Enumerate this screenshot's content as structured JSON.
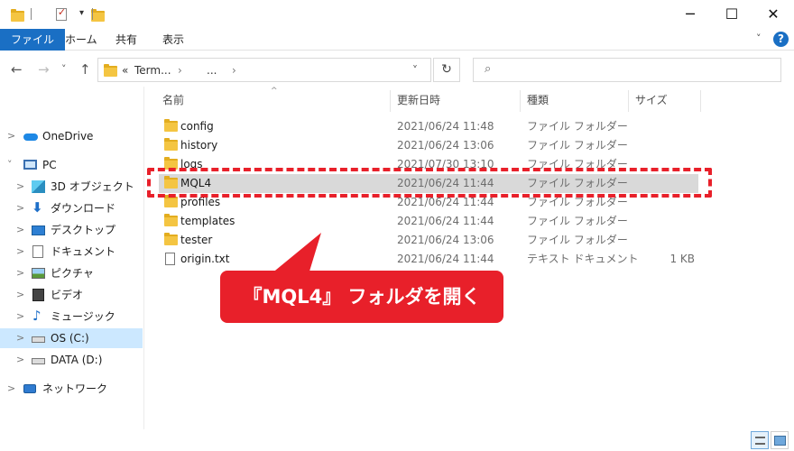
{
  "window": {
    "minimize": "─",
    "maximize": "☐",
    "close": "✕",
    "qa_dropdown": "▾"
  },
  "ribbon": {
    "tabs": [
      "ファイル",
      "ホーム",
      "共有",
      "表示"
    ],
    "expand": "˅",
    "help": "?"
  },
  "address": {
    "back": "←",
    "forward": "→",
    "recent": "˅",
    "up": "↑",
    "overflow": "«",
    "crumb1": "Term...",
    "crumb_sep": "›",
    "crumb2": "...",
    "crumb_sep2": "›",
    "dropdown": "˅",
    "refresh": "↻",
    "search_icon": "⌕"
  },
  "nav": {
    "items": [
      {
        "label": "OneDrive",
        "chevron": ">"
      },
      {
        "label": "PC",
        "chevron": "˅"
      },
      {
        "label": "3D オブジェクト",
        "chevron": ">"
      },
      {
        "label": "ダウンロード",
        "chevron": ">"
      },
      {
        "label": "デスクトップ",
        "chevron": ">"
      },
      {
        "label": "ドキュメント",
        "chevron": ">"
      },
      {
        "label": "ピクチャ",
        "chevron": ">"
      },
      {
        "label": "ビデオ",
        "chevron": ">"
      },
      {
        "label": "ミュージック",
        "chevron": ">"
      },
      {
        "label": "OS (C:)",
        "chevron": ">"
      },
      {
        "label": "DATA (D:)",
        "chevron": ">"
      },
      {
        "label": "ネットワーク",
        "chevron": ">"
      }
    ]
  },
  "columns": {
    "name": "名前",
    "date": "更新日時",
    "type": "種類",
    "size": "サイズ",
    "sort_indicator": "^"
  },
  "files": [
    {
      "name": "config",
      "date": "2021/06/24 11:48",
      "type": "ファイル フォルダー",
      "size": ""
    },
    {
      "name": "history",
      "date": "2021/06/24 13:06",
      "type": "ファイル フォルダー",
      "size": ""
    },
    {
      "name": "logs",
      "date": "2021/07/30 13:10",
      "type": "ファイル フォルダー",
      "size": ""
    },
    {
      "name": "MQL4",
      "date": "2021/06/24 11:44",
      "type": "ファイル フォルダー",
      "size": ""
    },
    {
      "name": "profiles",
      "date": "2021/06/24 11:44",
      "type": "ファイル フォルダー",
      "size": ""
    },
    {
      "name": "templates",
      "date": "2021/06/24 11:44",
      "type": "ファイル フォルダー",
      "size": ""
    },
    {
      "name": "tester",
      "date": "2021/06/24 13:06",
      "type": "ファイル フォルダー",
      "size": ""
    },
    {
      "name": "origin.txt",
      "date": "2021/06/24 11:44",
      "type": "テキスト ドキュメント",
      "size": "1 KB"
    }
  ],
  "annotation": {
    "text": "『MQL4』 フォルダを開く",
    "color": "#e8202a"
  }
}
